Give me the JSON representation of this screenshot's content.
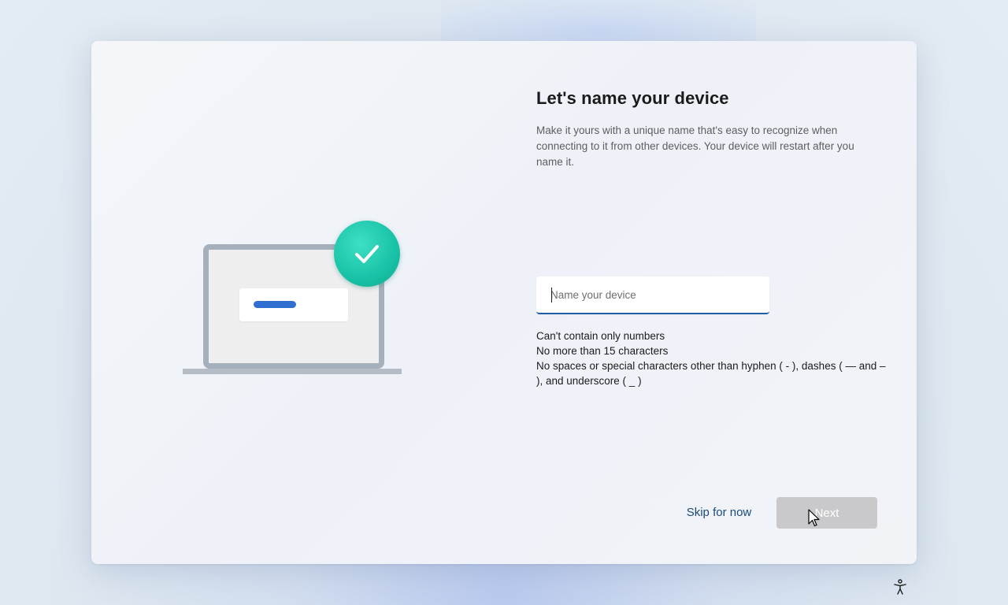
{
  "page": {
    "title": "Let's name your device",
    "description": "Make it yours with a unique name that's easy to recognize when connecting to it from other devices. Your device will restart after you name it."
  },
  "input": {
    "placeholder": "Name your device",
    "value": ""
  },
  "rules": [
    "Can't contain only numbers",
    "No more than 15 characters",
    "No spaces or special characters other than hyphen ( - ), dashes ( — and – ), and underscore ( _ )"
  ],
  "actions": {
    "skip_label": "Skip for now",
    "next_label": "Next"
  },
  "icons": {
    "check": "checkmark-icon",
    "accessibility": "accessibility-icon"
  },
  "colors": {
    "accent": "#1f5fa8",
    "check_green": "#18c2a6",
    "laptop_bar": "#2f6fd0",
    "next_disabled": "#c9c9cc"
  }
}
